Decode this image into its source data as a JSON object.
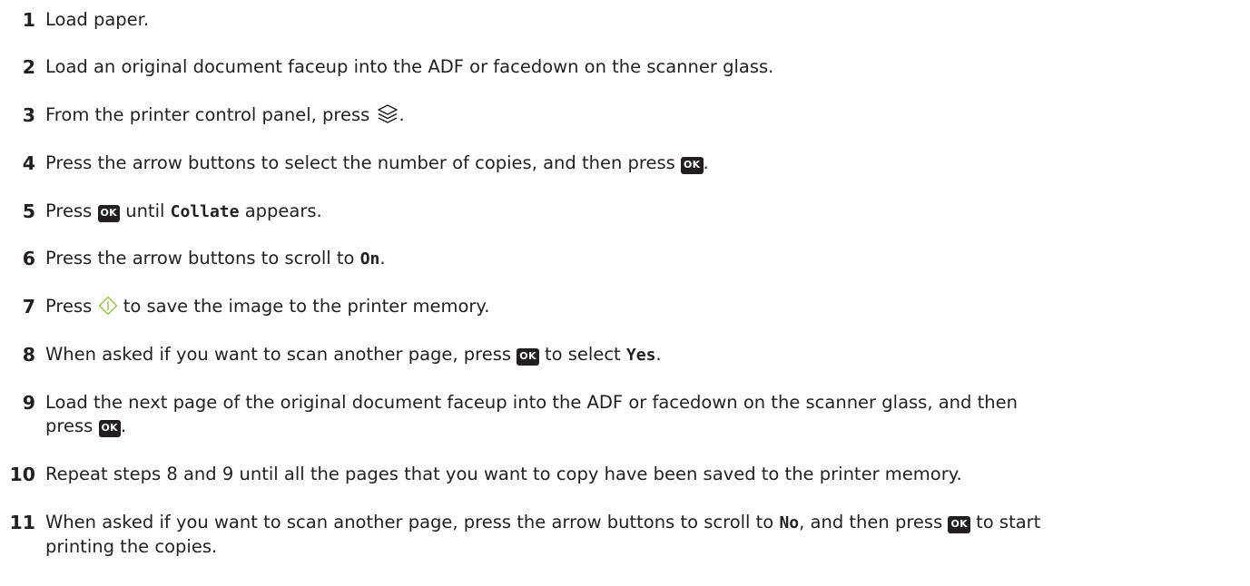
{
  "icons": {
    "ok_label": "OK"
  },
  "steps": [
    {
      "num": "1",
      "text": "Load paper."
    },
    {
      "num": "2",
      "text": "Load an original document faceup into the ADF or facedown on the scanner glass."
    },
    {
      "num": "3",
      "before": "From the printer control panel, press",
      "after": "."
    },
    {
      "num": "4",
      "before": "Press the arrow buttons to select the number of copies, and then press",
      "after": "."
    },
    {
      "num": "5",
      "before": "Press",
      "mid": "until",
      "code": "Collate",
      "after": "appears."
    },
    {
      "num": "6",
      "before": "Press the arrow buttons to scroll to",
      "code": "On",
      "after": "."
    },
    {
      "num": "7",
      "before": "Press",
      "after": "to save the image to the printer memory."
    },
    {
      "num": "8",
      "before": "When asked if you want to scan another page, press",
      "mid": "to select",
      "code": "Yes",
      "after": "."
    },
    {
      "num": "9",
      "line1": "Load the next page of the original document faceup into the ADF or facedown on the scanner glass, and then",
      "before": "press",
      "after": "."
    },
    {
      "num": "10",
      "text": "Repeat steps 8 and 9 until all the pages that you want to copy have been saved to the printer memory."
    },
    {
      "num": "11",
      "before": "When asked if you want to scan another page, press the arrow buttons to scroll to",
      "code": "No",
      "mid": ", and then press",
      "after": "to start",
      "line2": "printing the copies."
    }
  ]
}
